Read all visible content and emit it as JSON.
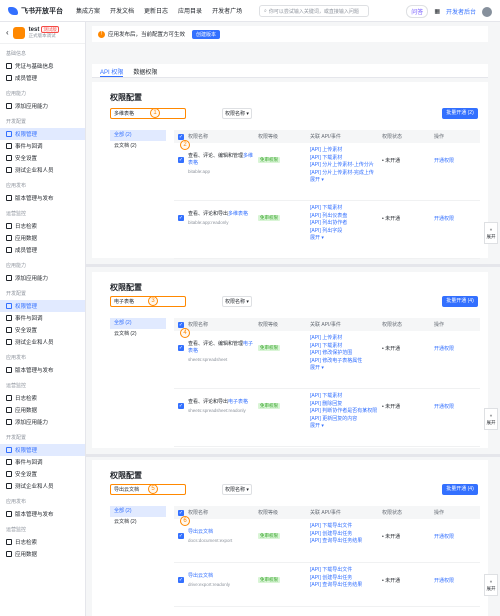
{
  "topnav": {
    "logo": "飞书开放平台",
    "items": [
      "集成方案",
      "开发文档",
      "更新日志",
      "应用目录",
      "开发者广场"
    ],
    "search_placeholder": "你可以尝试输入关键词，或直接输入问题",
    "ai_label": "问答",
    "dev_console": "开发者后台"
  },
  "app": {
    "name": "test",
    "tag": "测试版",
    "sub": "正式版本调试"
  },
  "sidebar": {
    "sections": [
      {
        "title": "基础信息",
        "items": [
          "凭证与基础信息",
          "成员管理"
        ]
      },
      {
        "title": "应用能力",
        "items": [
          "添加应用能力"
        ]
      },
      {
        "title": "开发配置",
        "items": [
          "权限管理",
          "事件与回调",
          "安全设置",
          "测试企业和人员"
        ]
      },
      {
        "title": "应用发布",
        "items": [
          "版本管理与发布"
        ]
      },
      {
        "title": "运营监控",
        "items": [
          "日志检索",
          "应用数据"
        ]
      }
    ],
    "lower": [
      "成员管理",
      "添加应用能力",
      "权限管理",
      "事件与回调",
      "安全设置",
      "测试企业和人员",
      "版本管理与发布",
      "日志检索",
      "应用数据"
    ],
    "lower_sections": [
      "应用能力",
      "开发配置",
      "应用发布",
      "运营监控"
    ],
    "lower2": [
      "添加应用能力",
      "权限管理",
      "事件与回调",
      "安全设置",
      "测试企业和人员",
      "版本管理与发布",
      "日志检索",
      "应用数据"
    ]
  },
  "notice": {
    "text": "应用发布后，当前配置方可生效",
    "button": "创建版本"
  },
  "tabs": [
    "API 权限",
    "数据权限"
  ],
  "panels": [
    {
      "title": "权限配置",
      "search": "多维表格",
      "badge": "1",
      "badge2": "2",
      "select": "权限名称",
      "bulk": "批量开通 (2)",
      "filters": [
        "全部 (2)",
        "云文档 (2)"
      ],
      "headers": [
        "权限名称",
        "权限等级",
        "关联 API/事件",
        "权限状态",
        "操作"
      ],
      "rows": [
        {
          "name_pre": "查看、评论、编辑和管理",
          "name_hl": "多维表格",
          "code": "bitable:app",
          "level": "免审权限",
          "apis": [
            "[API] 上传素材",
            "[API] 下载素材",
            "[API] 分片上传素材-上传分片",
            "[API] 分片上传素材-完成上传"
          ],
          "expand": "展开",
          "status": "未开通",
          "op": "开通权限"
        },
        {
          "name_pre": "查看、评论和导出",
          "name_hl": "多维表格",
          "code": "bitable:app:readonly",
          "level": "免审权限",
          "apis": [
            "[API] 下载素材",
            "[API] 列出仪表盘",
            "[API] 列出协作者",
            "[API] 列出字段"
          ],
          "expand": "展开",
          "status": "未开通",
          "op": "开通权限"
        }
      ]
    },
    {
      "title": "权限配置",
      "search": "电子表格",
      "badge": "3",
      "badge2": "4",
      "select": "权限名称",
      "bulk": "批量开通 (4)",
      "filters": [
        "全部 (2)",
        "云文档 (2)"
      ],
      "headers": [
        "权限名称",
        "权限等级",
        "关联 API/事件",
        "权限状态",
        "操作"
      ],
      "rows": [
        {
          "name_pre": "查看、评论、编辑和管理",
          "name_hl": "电子表格",
          "code": "sheets:spreadsheet",
          "level": "免审权限",
          "apis": [
            "[API] 上传素材",
            "[API] 下载素材",
            "[API] 修改保护范围",
            "[API] 修改电子表格属性"
          ],
          "expand": "展开",
          "status": "未开通",
          "op": "开通权限"
        },
        {
          "name_pre": "查看、评论和导出",
          "name_hl": "电子表格",
          "code": "sheets:spreadsheet:readonly",
          "level": "免审权限",
          "apis": [
            "[API] 下载素材",
            "[API] 删除回复",
            "[API] 判断协作者是否有某权限",
            "[API] 更新回复的内容"
          ],
          "expand": "展开",
          "status": "未开通",
          "op": "开通权限"
        }
      ]
    },
    {
      "title": "权限配置",
      "search": "导出云文档",
      "badge": "5",
      "badge2": "6",
      "select": "权限名称",
      "bulk": "批量开通 (4)",
      "filters": [
        "全部 (2)",
        "云文档 (2)"
      ],
      "headers": [
        "权限名称",
        "权限等级",
        "关联 API/事件",
        "权限状态",
        "操作"
      ],
      "rows": [
        {
          "name_pre": "",
          "name_hl": "导出云文档",
          "code": "docs:document:export",
          "level": "免审权限",
          "apis": [
            "[API] 下载导出文件",
            "[API] 创建导出任务",
            "[API] 查询导出任务结果"
          ],
          "expand": "",
          "status": "未开通",
          "op": "开通权限"
        },
        {
          "name_pre": "",
          "name_hl": "导出云文档",
          "code": "drive:export:readonly",
          "level": "免审权限",
          "apis": [
            "[API] 下载导出文件",
            "[API] 创建导出任务",
            "[API] 查询导出任务结果"
          ],
          "expand": "",
          "status": "未开通",
          "op": "开通权限"
        }
      ]
    }
  ],
  "float": {
    "label": "展开"
  }
}
